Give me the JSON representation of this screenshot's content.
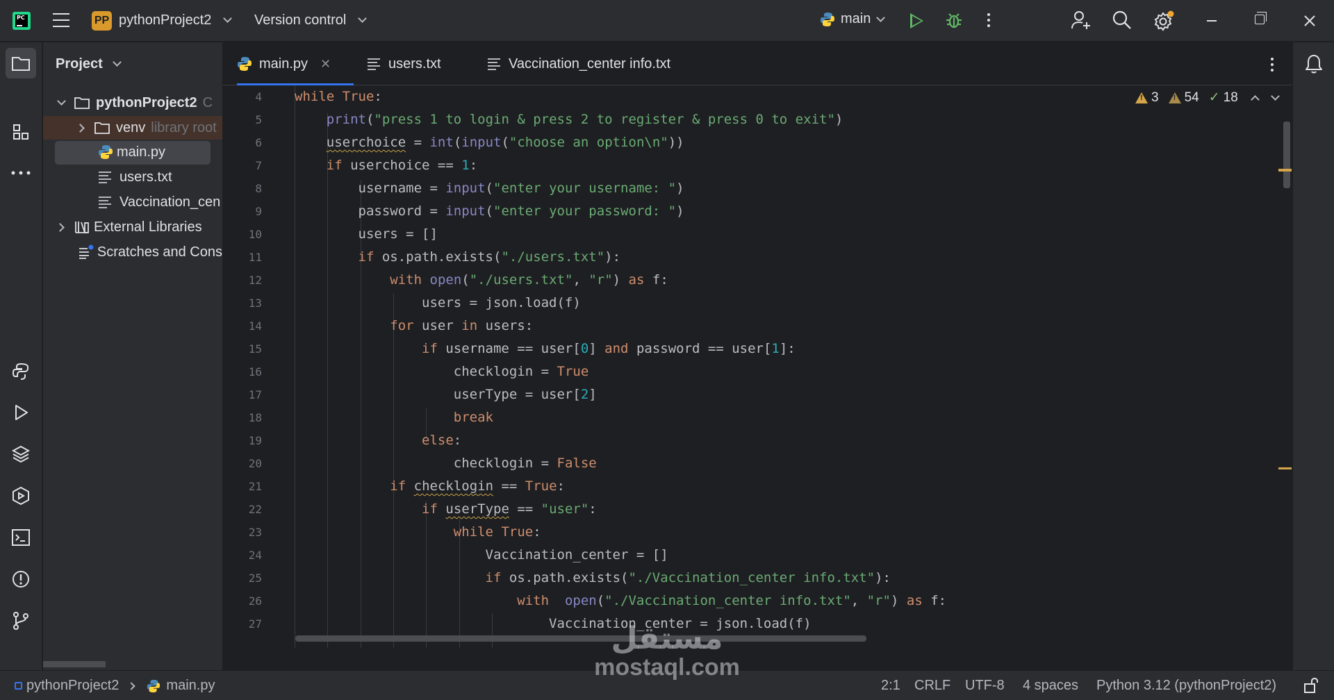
{
  "titlebar": {
    "project_badge": "PP",
    "project_name": "pythonProject2",
    "version_control": "Version control",
    "run_config": "main"
  },
  "project_panel": {
    "title": "Project",
    "tree": [
      {
        "label": "pythonProject2",
        "suffix": "C"
      },
      {
        "label": "venv",
        "suffix": "library root"
      },
      {
        "label": "main.py",
        "suffix": ""
      },
      {
        "label": "users.txt",
        "suffix": ""
      },
      {
        "label": "Vaccination_cen",
        "suffix": ""
      },
      {
        "label": "External Libraries",
        "suffix": ""
      },
      {
        "label": "Scratches and Cons",
        "suffix": ""
      }
    ]
  },
  "tabs": [
    {
      "label": "main.py",
      "active": true
    },
    {
      "label": "users.txt",
      "active": false
    },
    {
      "label": "Vaccination_center info.txt",
      "active": false
    }
  ],
  "inspections": {
    "warnings": "3",
    "weak_warnings": "54",
    "typos": "18"
  },
  "line_numbers": [
    "4",
    "5",
    "6",
    "7",
    "8",
    "9",
    "10",
    "11",
    "12",
    "13",
    "14",
    "15",
    "16",
    "17",
    "18",
    "19",
    "20",
    "21",
    "22",
    "23",
    "24",
    "25",
    "26",
    "27"
  ],
  "code": [
    "while True:",
    "    print(\"press 1 to login & press 2 to register & press 0 to exit\")",
    "    userchoice = int(input(\"choose an option\\n\"))",
    "    if userchoice == 1:",
    "        username = input(\"enter your username: \")",
    "        password = input(\"enter your password: \")",
    "        users = []",
    "        if os.path.exists(\"./users.txt\"):",
    "            with open(\"./users.txt\", \"r\") as f:",
    "                users = json.load(f)",
    "            for user in users:",
    "                if username == user[0] and password == user[1]:",
    "                    checklogin = True",
    "                    userType = user[2]",
    "                    break",
    "                else:",
    "                    checklogin = False",
    "            if checklogin == True:",
    "                if userType == \"user\":",
    "                    while True:",
    "                        Vaccination_center = []",
    "                        if os.path.exists(\"./Vaccination_center info.txt\"):",
    "                            with  open(\"./Vaccination_center info.txt\", \"r\") as f:",
    "                                Vaccination_center = json.load(f)"
  ],
  "statusbar": {
    "breadcrumb_project": "pythonProject2",
    "breadcrumb_file": "main.py",
    "position": "2:1",
    "line_sep": "CRLF",
    "encoding": "UTF-8",
    "indent": "4 spaces",
    "interpreter": "Python 3.12 (pythonProject2)"
  },
  "watermark": {
    "arabic": "مستقل",
    "latin": "mostaql.com"
  },
  "colors": {
    "accent": "#3574f0",
    "run": "#5fb865",
    "warning": "#d6a44b",
    "keyword": "#cf8e6d",
    "string": "#6aab73",
    "function": "#56a8f5",
    "number": "#2aacb8"
  }
}
